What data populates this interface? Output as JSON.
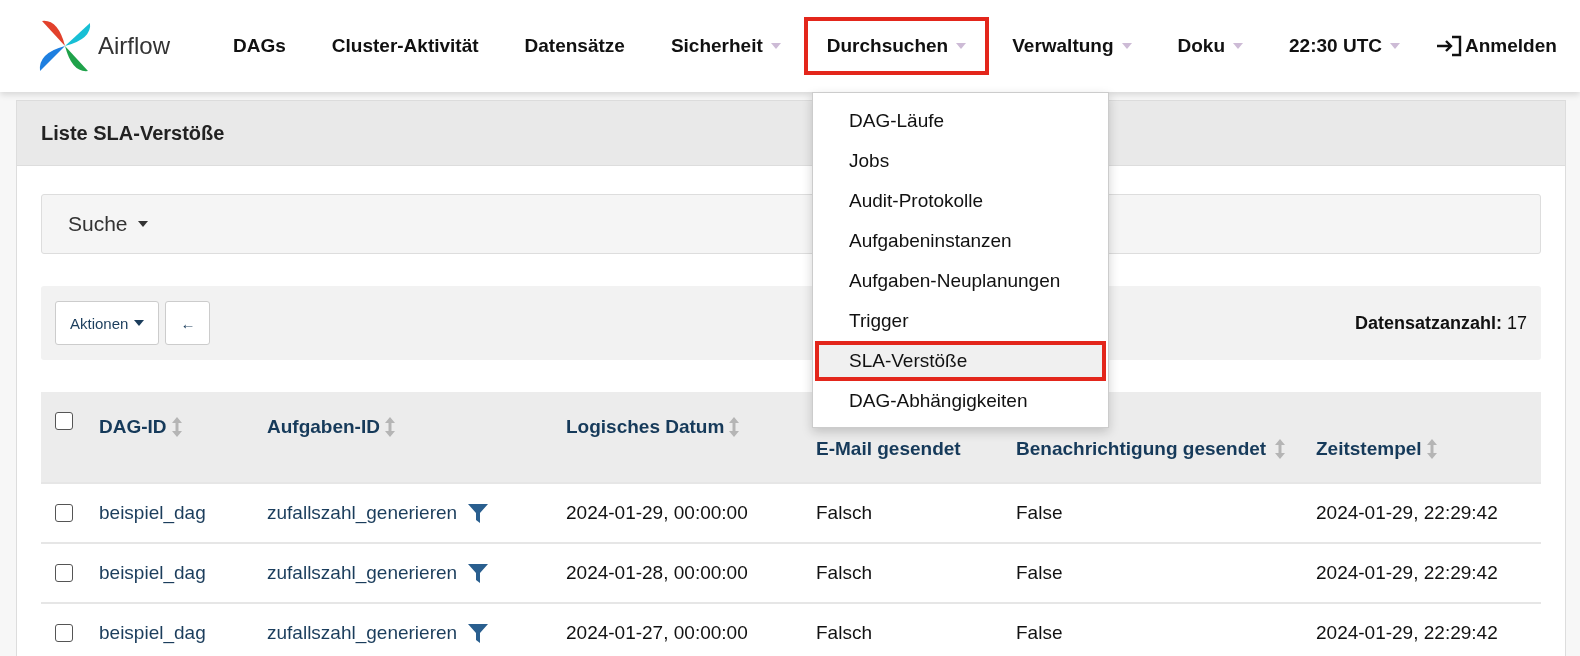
{
  "navbar": {
    "brand": "Airflow",
    "items": [
      {
        "label": "DAGs",
        "dropdown": false,
        "highlighted": false
      },
      {
        "label": "Cluster-Aktivität",
        "dropdown": false,
        "highlighted": false
      },
      {
        "label": "Datensätze",
        "dropdown": false,
        "highlighted": false
      },
      {
        "label": "Sicherheit",
        "dropdown": true,
        "highlighted": false
      },
      {
        "label": "Durchsuchen",
        "dropdown": true,
        "highlighted": true
      },
      {
        "label": "Verwaltung",
        "dropdown": true,
        "highlighted": false
      },
      {
        "label": "Doku",
        "dropdown": true,
        "highlighted": false
      },
      {
        "label": "22:30 UTC",
        "dropdown": true,
        "highlighted": false
      }
    ],
    "login": "Anmelden"
  },
  "menu": {
    "items": [
      {
        "label": "DAG-Läufe",
        "highlighted": false
      },
      {
        "label": "Jobs",
        "highlighted": false
      },
      {
        "label": "Audit-Protokolle",
        "highlighted": false
      },
      {
        "label": "Aufgabeninstanzen",
        "highlighted": false
      },
      {
        "label": "Aufgaben-Neuplanungen",
        "highlighted": false
      },
      {
        "label": "Trigger",
        "highlighted": false
      },
      {
        "label": "SLA-Verstöße",
        "highlighted": true
      },
      {
        "label": "DAG-Abhängigkeiten",
        "highlighted": false
      }
    ]
  },
  "panel": {
    "title": "Liste SLA-Verstöße",
    "search": "Suche",
    "actions": "Aktionen",
    "back": "←",
    "count_label": "Datensatzanzahl:",
    "count": "17"
  },
  "table": {
    "select_all_checked": false,
    "columns": [
      {
        "label": "DAG-ID",
        "sortable": true
      },
      {
        "label": "Aufgaben-ID",
        "sortable": true
      },
      {
        "label": "Logisches Datum",
        "sortable": true
      },
      {
        "label": "E-Mail gesendet",
        "sortable": false
      },
      {
        "label": "Benachrichtigung gesendet",
        "sortable": true
      },
      {
        "label": "Zeitstempel",
        "sortable": true
      }
    ],
    "rows": [
      {
        "checked": false,
        "dag_id": "beispiel_dag",
        "task_id": "zufallszahl_generieren",
        "date": "2024-01-29, 00:00:00",
        "email_sent": "Falsch",
        "notification_sent": "False",
        "timestamp": "2024-01-29, 22:29:42"
      },
      {
        "checked": false,
        "dag_id": "beispiel_dag",
        "task_id": "zufallszahl_generieren",
        "date": "2024-01-28, 00:00:00",
        "email_sent": "Falsch",
        "notification_sent": "False",
        "timestamp": "2024-01-29, 22:29:42"
      },
      {
        "checked": false,
        "dag_id": "beispiel_dag",
        "task_id": "zufallszahl_generieren",
        "date": "2024-01-27, 00:00:00",
        "email_sent": "Falsch",
        "notification_sent": "False",
        "timestamp": "2024-01-29, 22:29:42"
      }
    ]
  }
}
